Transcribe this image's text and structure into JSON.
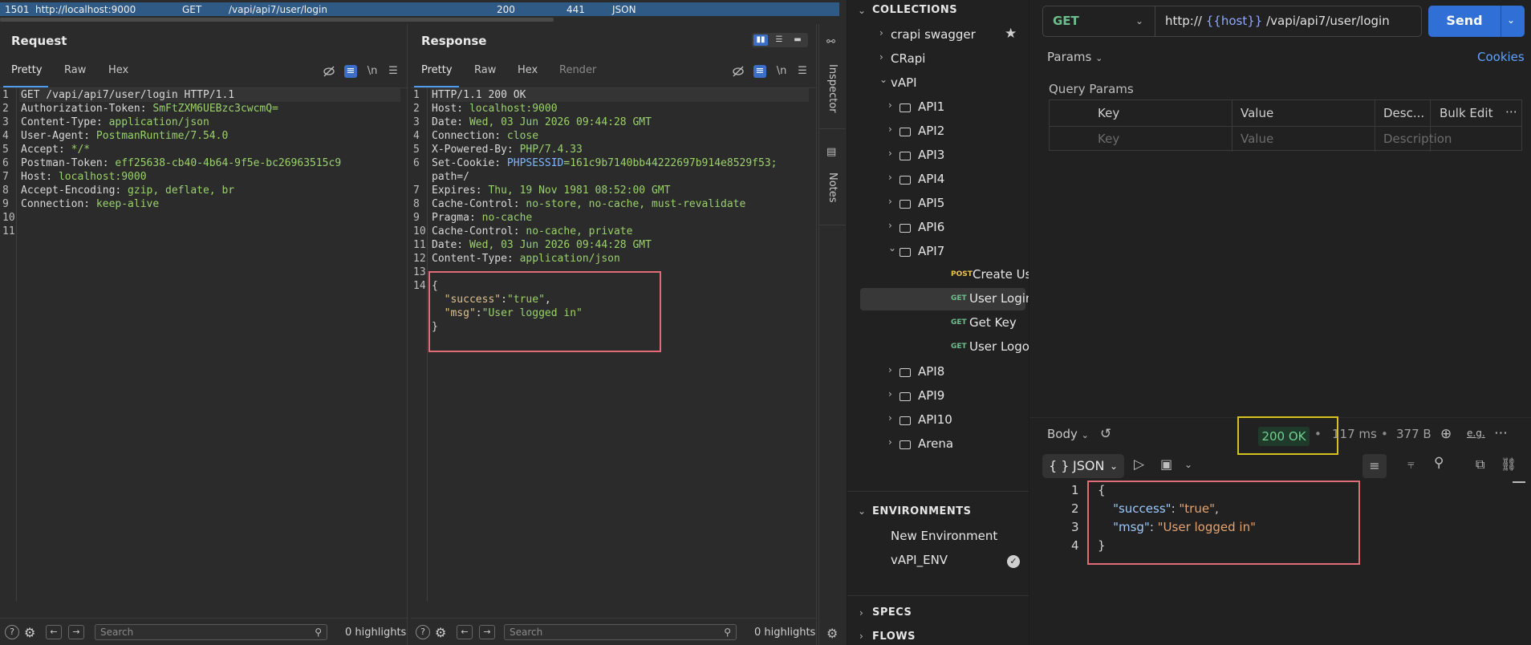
{
  "history_row": {
    "id": "1501",
    "host": "http://localhost:9000",
    "method": "GET",
    "path": "/vapi/api7/user/login",
    "status": "200",
    "length": "441",
    "mime": "JSON"
  },
  "request": {
    "title": "Request",
    "tabs": [
      "Pretty",
      "Raw",
      "Hex"
    ],
    "wrap_label": "\\n",
    "lines": [
      {
        "n": "1",
        "k": "GET /vapi/api7/user/login HTTP/1.1",
        "v": ""
      },
      {
        "n": "2",
        "k": "Authorization-Token:",
        "v": " SmFtZXM6UEBzc3cwcmQ="
      },
      {
        "n": "3",
        "k": "Content-Type:",
        "v": " application/json"
      },
      {
        "n": "4",
        "k": "User-Agent:",
        "v": " PostmanRuntime/7.54.0"
      },
      {
        "n": "5",
        "k": "Accept:",
        "v": " */*"
      },
      {
        "n": "6",
        "k": "Postman-Token:",
        "v": " eff25638-cb40-4b64-9f5e-bc26963515c9"
      },
      {
        "n": "7",
        "k": "Host:",
        "v": " localhost:9000"
      },
      {
        "n": "8",
        "k": "Accept-Encoding:",
        "v": " gzip, deflate, br"
      },
      {
        "n": "9",
        "k": "Connection:",
        "v": " keep-alive"
      },
      {
        "n": "10",
        "k": "",
        "v": ""
      },
      {
        "n": "11",
        "k": "",
        "v": ""
      }
    ],
    "search_placeholder": "Search",
    "highlights": "0 highlights"
  },
  "response": {
    "title": "Response",
    "tabs": [
      "Pretty",
      "Raw",
      "Hex",
      "Render"
    ],
    "wrap_label": "\\n",
    "lines": [
      {
        "n": "1",
        "k": "HTTP/1.1 200 OK",
        "v": ""
      },
      {
        "n": "2",
        "k": "Host:",
        "v": " localhost:9000"
      },
      {
        "n": "3",
        "k": "Date:",
        "v": " Wed, 03 Jun 2026 09:44:28 GMT"
      },
      {
        "n": "4",
        "k": "Connection:",
        "v": " close"
      },
      {
        "n": "5",
        "k": "X-Powered-By:",
        "v": " PHP/7.4.33"
      },
      {
        "n": "6",
        "k": "Set-Cookie:",
        "v": " PHPSESSID=161c9b7140bb44222697b914e8529f53;"
      },
      {
        "n": "",
        "k": "path=/",
        "v": ""
      },
      {
        "n": "7",
        "k": "Expires:",
        "v": " Thu, 19 Nov 1981 08:52:00 GMT"
      },
      {
        "n": "8",
        "k": "Cache-Control:",
        "v": " no-store, no-cache, must-revalidate"
      },
      {
        "n": "9",
        "k": "Pragma:",
        "v": " no-cache"
      },
      {
        "n": "10",
        "k": "Cache-Control:",
        "v": " no-cache, private"
      },
      {
        "n": "11",
        "k": "Date:",
        "v": " Wed, 03 Jun 2026 09:44:28 GMT"
      },
      {
        "n": "12",
        "k": "Content-Type:",
        "v": " application/json"
      },
      {
        "n": "13",
        "k": "",
        "v": ""
      },
      {
        "n": "14",
        "k": "{",
        "v": ""
      }
    ],
    "cookie_name": "PHPSESSID",
    "cookie_value": "=161c9b7140bb44222697b914e8529f53;",
    "cookie_key": "Set-Cookie:",
    "body_line1_key": "\"success\"",
    "body_line1_val": "\"true\"",
    "body_line2_key": "\"msg\"",
    "body_line2_val": "\"User logged in\"",
    "body_close": "}",
    "search_placeholder": "Search",
    "highlights": "0 highlights"
  },
  "side_strip": {
    "inspector": "Inspector",
    "notes": "Notes"
  },
  "postman_sidebar": {
    "collections_header": "COLLECTIONS",
    "collections": [
      {
        "label": "crapi swagger",
        "starred": true
      },
      {
        "label": "CRapi"
      },
      {
        "label": "vAPI"
      }
    ],
    "folders": [
      "API1",
      "API2",
      "API3",
      "API4",
      "API5",
      "API6",
      "API7"
    ],
    "api7_requests": [
      {
        "method": "POST",
        "label": "Create User"
      },
      {
        "method": "GET",
        "label": "User Login",
        "selected": true
      },
      {
        "method": "GET",
        "label": "Get Key"
      },
      {
        "method": "GET",
        "label": "User Logout"
      }
    ],
    "more_folders": [
      "API8",
      "API9",
      "API10",
      "Arena"
    ],
    "environments_header": "ENVIRONMENTS",
    "environments": [
      {
        "label": "New Environment"
      },
      {
        "label": "vAPI_ENV",
        "active": true
      }
    ],
    "specs_header": "SPECS",
    "flows_header": "FLOWS"
  },
  "postman_main": {
    "method": "GET",
    "url_prefix": "http://",
    "url_var": "{{host}}",
    "url_path": " /vapi/api7/user/login",
    "send_label": "Send",
    "params_tab": "Params",
    "cookies_link": "Cookies",
    "query_params_title": "Query Params",
    "qp_headers": [
      "Key",
      "Value",
      "Desc...",
      "Bulk Edit"
    ],
    "qp_placeholders": [
      "Key",
      "Value",
      "Description"
    ],
    "body_label": "Body",
    "status": "200 OK",
    "time": "117 ms",
    "size": "377 B",
    "format_label": "JSON",
    "format_prefix": "{ }",
    "e_g_label": "e.g.",
    "response_lines": [
      {
        "n": "1",
        "text": "{"
      },
      {
        "n": "2",
        "key": "\"success\"",
        "val": "\"true\""
      },
      {
        "n": "3",
        "key": "\"msg\"",
        "val": "\"User logged in\""
      },
      {
        "n": "4",
        "text": "}"
      }
    ]
  },
  "colors": {
    "accent_blue": "#2f6fd6",
    "status_green": "#6fd08f",
    "highlight_red": "#e06c75",
    "highlight_yellow": "#d6c21f"
  }
}
